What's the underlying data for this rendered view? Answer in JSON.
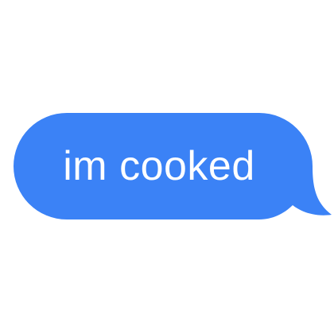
{
  "message": {
    "text": "im cooked",
    "bubble_color": "#3b82f6",
    "text_color": "#ffffff",
    "direction": "outgoing"
  }
}
